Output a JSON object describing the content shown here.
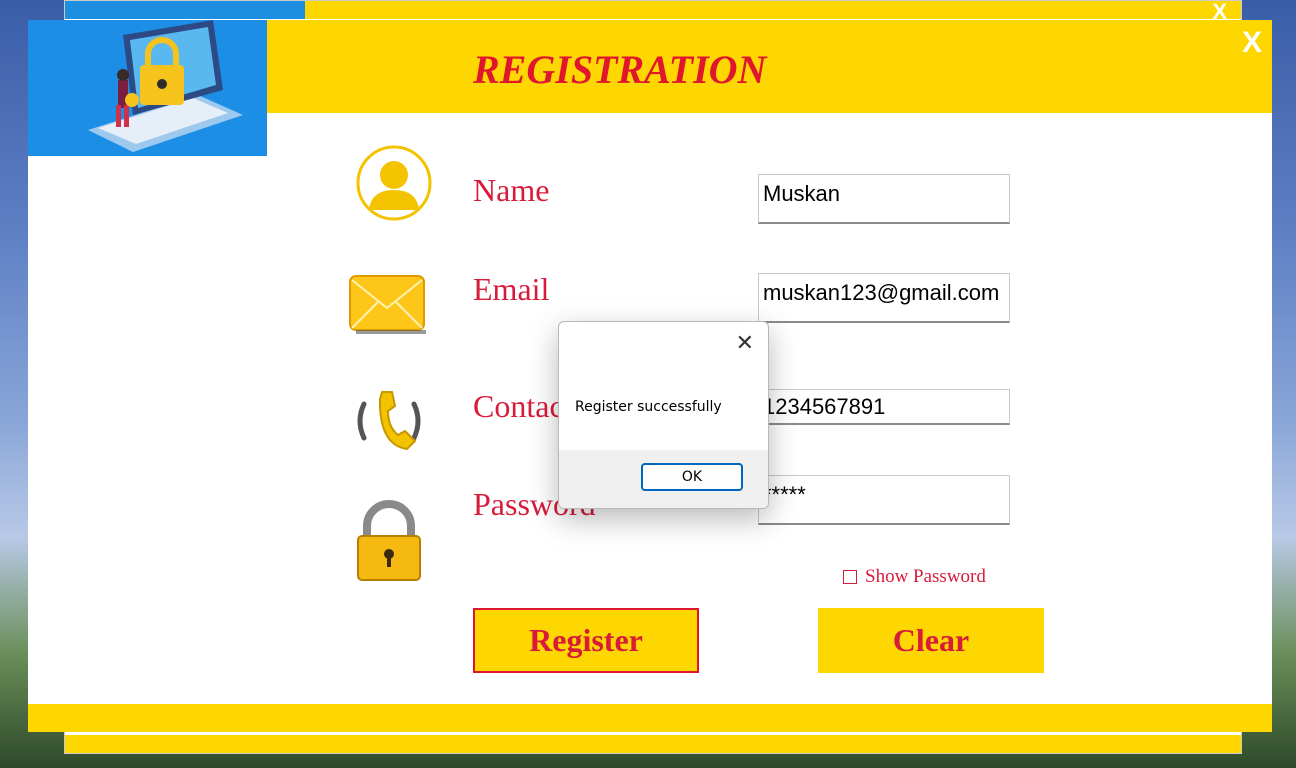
{
  "window": {
    "title": "REGISTRATION",
    "close_glyph": "X"
  },
  "form": {
    "name": {
      "label": "Name",
      "value": "Muskan"
    },
    "email": {
      "label": "Email",
      "value": "muskan123@gmail.com"
    },
    "contact": {
      "label": "Contact",
      "value": "1234567891"
    },
    "password": {
      "label": "Password",
      "value": "*****"
    },
    "show_password": {
      "label": "Show Password",
      "checked": false
    }
  },
  "buttons": {
    "register": "Register",
    "clear": "Clear"
  },
  "dialog": {
    "message": "Register successfully",
    "ok": "OK",
    "close_glyph": "✕"
  },
  "colors": {
    "accent": "#ffd700",
    "label_red": "#d81b3a",
    "logo_blue": "#1d8ee6"
  },
  "icons": [
    "laptop-lock-illustration",
    "user-icon",
    "envelope-icon",
    "phone-icon",
    "padlock-icon"
  ]
}
